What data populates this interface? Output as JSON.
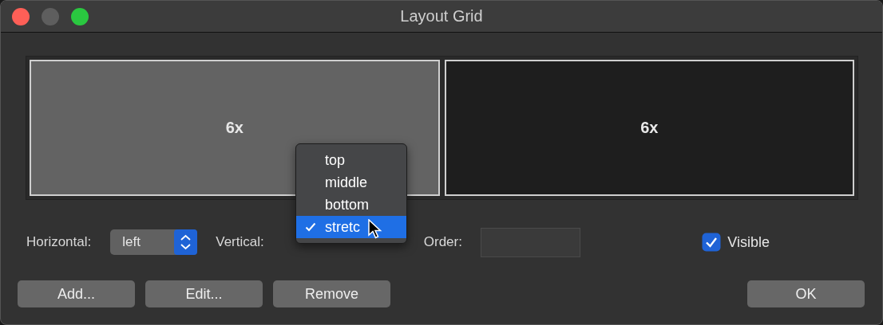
{
  "window": {
    "title": "Layout Grid"
  },
  "grid_preview": {
    "cells": [
      {
        "label": "6x",
        "selected": true
      },
      {
        "label": "6x",
        "selected": false
      }
    ]
  },
  "horizontal": {
    "label": "Horizontal:",
    "value": "left"
  },
  "vertical": {
    "label": "Vertical:",
    "menu": [
      {
        "label": "top",
        "selected": false
      },
      {
        "label": "middle",
        "selected": false
      },
      {
        "label": "bottom",
        "selected": false
      },
      {
        "label": "stretc",
        "selected": true
      }
    ]
  },
  "order": {
    "label": "Order:"
  },
  "visible": {
    "label": "Visible",
    "checked": true
  },
  "buttons": [
    {
      "label": "Add..."
    },
    {
      "label": "Edit..."
    },
    {
      "label": "Remove"
    }
  ],
  "ok_button": {
    "label": "OK"
  }
}
